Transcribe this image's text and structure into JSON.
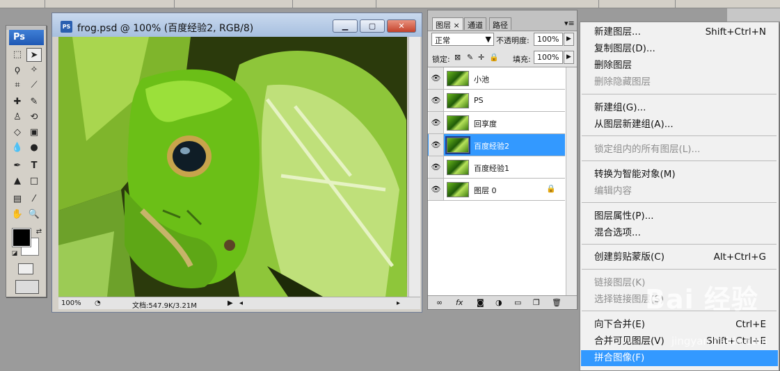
{
  "toolbox": {
    "logo": "Ps"
  },
  "document": {
    "title": "frog.psd @ 100% (百度经验2, RGB/8)",
    "icon_label": "PS",
    "zoom": "100%",
    "doc_info": "文档:547.9K/3.21M"
  },
  "layers_panel": {
    "tabs": [
      "图层",
      "通道",
      "路径"
    ],
    "tab_close": "×",
    "blend_mode": "正常",
    "opacity_label": "不透明度:",
    "opacity": "100%",
    "lock_label": "锁定:",
    "fill_label": "填充:",
    "fill": "100%",
    "layers": [
      {
        "name": "小池",
        "selected": false
      },
      {
        "name": "PS",
        "selected": false
      },
      {
        "name": "回享度",
        "selected": false
      },
      {
        "name": "百度经验2",
        "selected": true
      },
      {
        "name": "百度经验1",
        "selected": false
      },
      {
        "name": "图层 0",
        "selected": false,
        "locked": true
      }
    ],
    "bottom_icons": [
      "link-icon",
      "fx-icon",
      "mask-icon",
      "adjustment-icon",
      "group-icon",
      "new-layer-icon",
      "trash-icon"
    ]
  },
  "context_menu": {
    "items": [
      {
        "label": "新建图层...",
        "shortcut": "Shift+Ctrl+N",
        "disabled": false
      },
      {
        "label": "复制图层(D)...",
        "shortcut": "",
        "disabled": false
      },
      {
        "label": "删除图层",
        "shortcut": "",
        "disabled": false
      },
      {
        "label": "删除隐藏图层",
        "shortcut": "",
        "disabled": true
      },
      {
        "label": "新建组(G)...",
        "shortcut": "",
        "disabled": false
      },
      {
        "label": "从图层新建组(A)...",
        "shortcut": "",
        "disabled": false
      },
      {
        "label": "锁定组内的所有图层(L)...",
        "shortcut": "",
        "disabled": true
      },
      {
        "label": "转换为智能对象(M)",
        "shortcut": "",
        "disabled": false
      },
      {
        "label": "编辑内容",
        "shortcut": "",
        "disabled": true
      },
      {
        "label": "图层属性(P)...",
        "shortcut": "",
        "disabled": false
      },
      {
        "label": "混合选项...",
        "shortcut": "",
        "disabled": false
      },
      {
        "label": "创建剪贴蒙版(C)",
        "shortcut": "Alt+Ctrl+G",
        "disabled": false
      },
      {
        "label": "链接图层(K)",
        "shortcut": "",
        "disabled": true
      },
      {
        "label": "选择链接图层(S)",
        "shortcut": "",
        "disabled": true
      },
      {
        "label": "向下合并(E)",
        "shortcut": "Ctrl+E",
        "disabled": false
      },
      {
        "label": "合并可见图层(V)",
        "shortcut": "Shift+Ctrl+E",
        "disabled": false
      },
      {
        "label": "拼合图像(F)",
        "shortcut": "",
        "disabled": false,
        "highlighted": true
      }
    ]
  },
  "watermark": {
    "text": "Bai 经验",
    "sub": "jingyan.baidu.com"
  }
}
